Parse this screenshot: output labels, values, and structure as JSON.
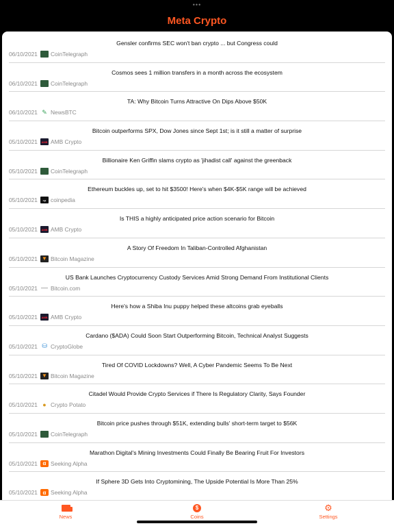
{
  "app": {
    "title": "Meta Crypto"
  },
  "news": [
    {
      "title": "Gensler confirms SEC won't ban crypto ... but Congress could",
      "date": "06/10/2021",
      "source": "CoinTelegraph",
      "icon": "cointelegraph"
    },
    {
      "title": "Cosmos sees 1 million transfers in a month across the ecosystem",
      "date": "06/10/2021",
      "source": "CoinTelegraph",
      "icon": "cointelegraph"
    },
    {
      "title": "TA: Why Bitcoin Turns Attractive On Dips Above $50K",
      "date": "06/10/2021",
      "source": "NewsBTC",
      "icon": "newsbtc"
    },
    {
      "title": "Bitcoin outperforms SPX, Dow Jones since Sept 1st; is it still a matter of surprise",
      "date": "05/10/2021",
      "source": "AMB Crypto",
      "icon": "amb"
    },
    {
      "title": "Billionaire Ken Griffin slams crypto as 'jihadist call' against the greenback",
      "date": "05/10/2021",
      "source": "CoinTelegraph",
      "icon": "cointelegraph"
    },
    {
      "title": "Ethereum buckles up, set to hit $3500! Here's when $4K-$5K range will be achieved",
      "date": "05/10/2021",
      "source": "coinpedia",
      "icon": "coinpedia"
    },
    {
      "title": "Is THIS a highly anticipated price action scenario for Bitcoin",
      "date": "05/10/2021",
      "source": "AMB Crypto",
      "icon": "amb"
    },
    {
      "title": "A Story Of Freedom In Taliban-Controlled Afghanistan",
      "date": "05/10/2021",
      "source": "Bitcoin Magazine",
      "icon": "btcmag"
    },
    {
      "title": "US Bank Launches Cryptocurrency Custody Services Amid Strong Demand From Institutional Clients",
      "date": "05/10/2021",
      "source": "Bitcoin.com",
      "icon": "bitcoincom"
    },
    {
      "title": "Here's how a Shiba Inu puppy helped these altcoins grab eyeballs",
      "date": "05/10/2021",
      "source": "AMB Crypto",
      "icon": "amb"
    },
    {
      "title": "Cardano ($ADA) Could Soon Start Outperforming Bitcoin, Technical Analyst Suggests",
      "date": "05/10/2021",
      "source": "CryptoGlobe",
      "icon": "cryptoglobe"
    },
    {
      "title": "Tired Of COVID Lockdowns? Well, A Cyber Pandemic Seems To Be Next",
      "date": "05/10/2021",
      "source": "Bitcoin Magazine",
      "icon": "btcmag"
    },
    {
      "title": "Citadel Would Provide Crypto Services if There Is Regulatory Clarity, Says Founder",
      "date": "05/10/2021",
      "source": "Crypto Potato",
      "icon": "potato"
    },
    {
      "title": "Bitcoin price pushes through $51K, extending bulls' short-term target to $56K",
      "date": "05/10/2021",
      "source": "CoinTelegraph",
      "icon": "cointelegraph"
    },
    {
      "title": "Marathon Digital's Mining Investments Could Finally Be Bearing Fruit For Investors",
      "date": "05/10/2021",
      "source": "Seeking Alpha",
      "icon": "seeking"
    },
    {
      "title": "If Sphere 3D Gets Into Cryptomining, The Upside Potential Is More Than 25%",
      "date": "05/10/2021",
      "source": "Seeking Alpha",
      "icon": "seeking"
    }
  ],
  "tabs": [
    {
      "label": "News",
      "icon": "news-icon"
    },
    {
      "label": "Coins",
      "icon": "coin-icon"
    },
    {
      "label": "Settings",
      "icon": "gear-icon"
    }
  ],
  "colors": {
    "accent": "#ff5722",
    "background": "#000000"
  }
}
